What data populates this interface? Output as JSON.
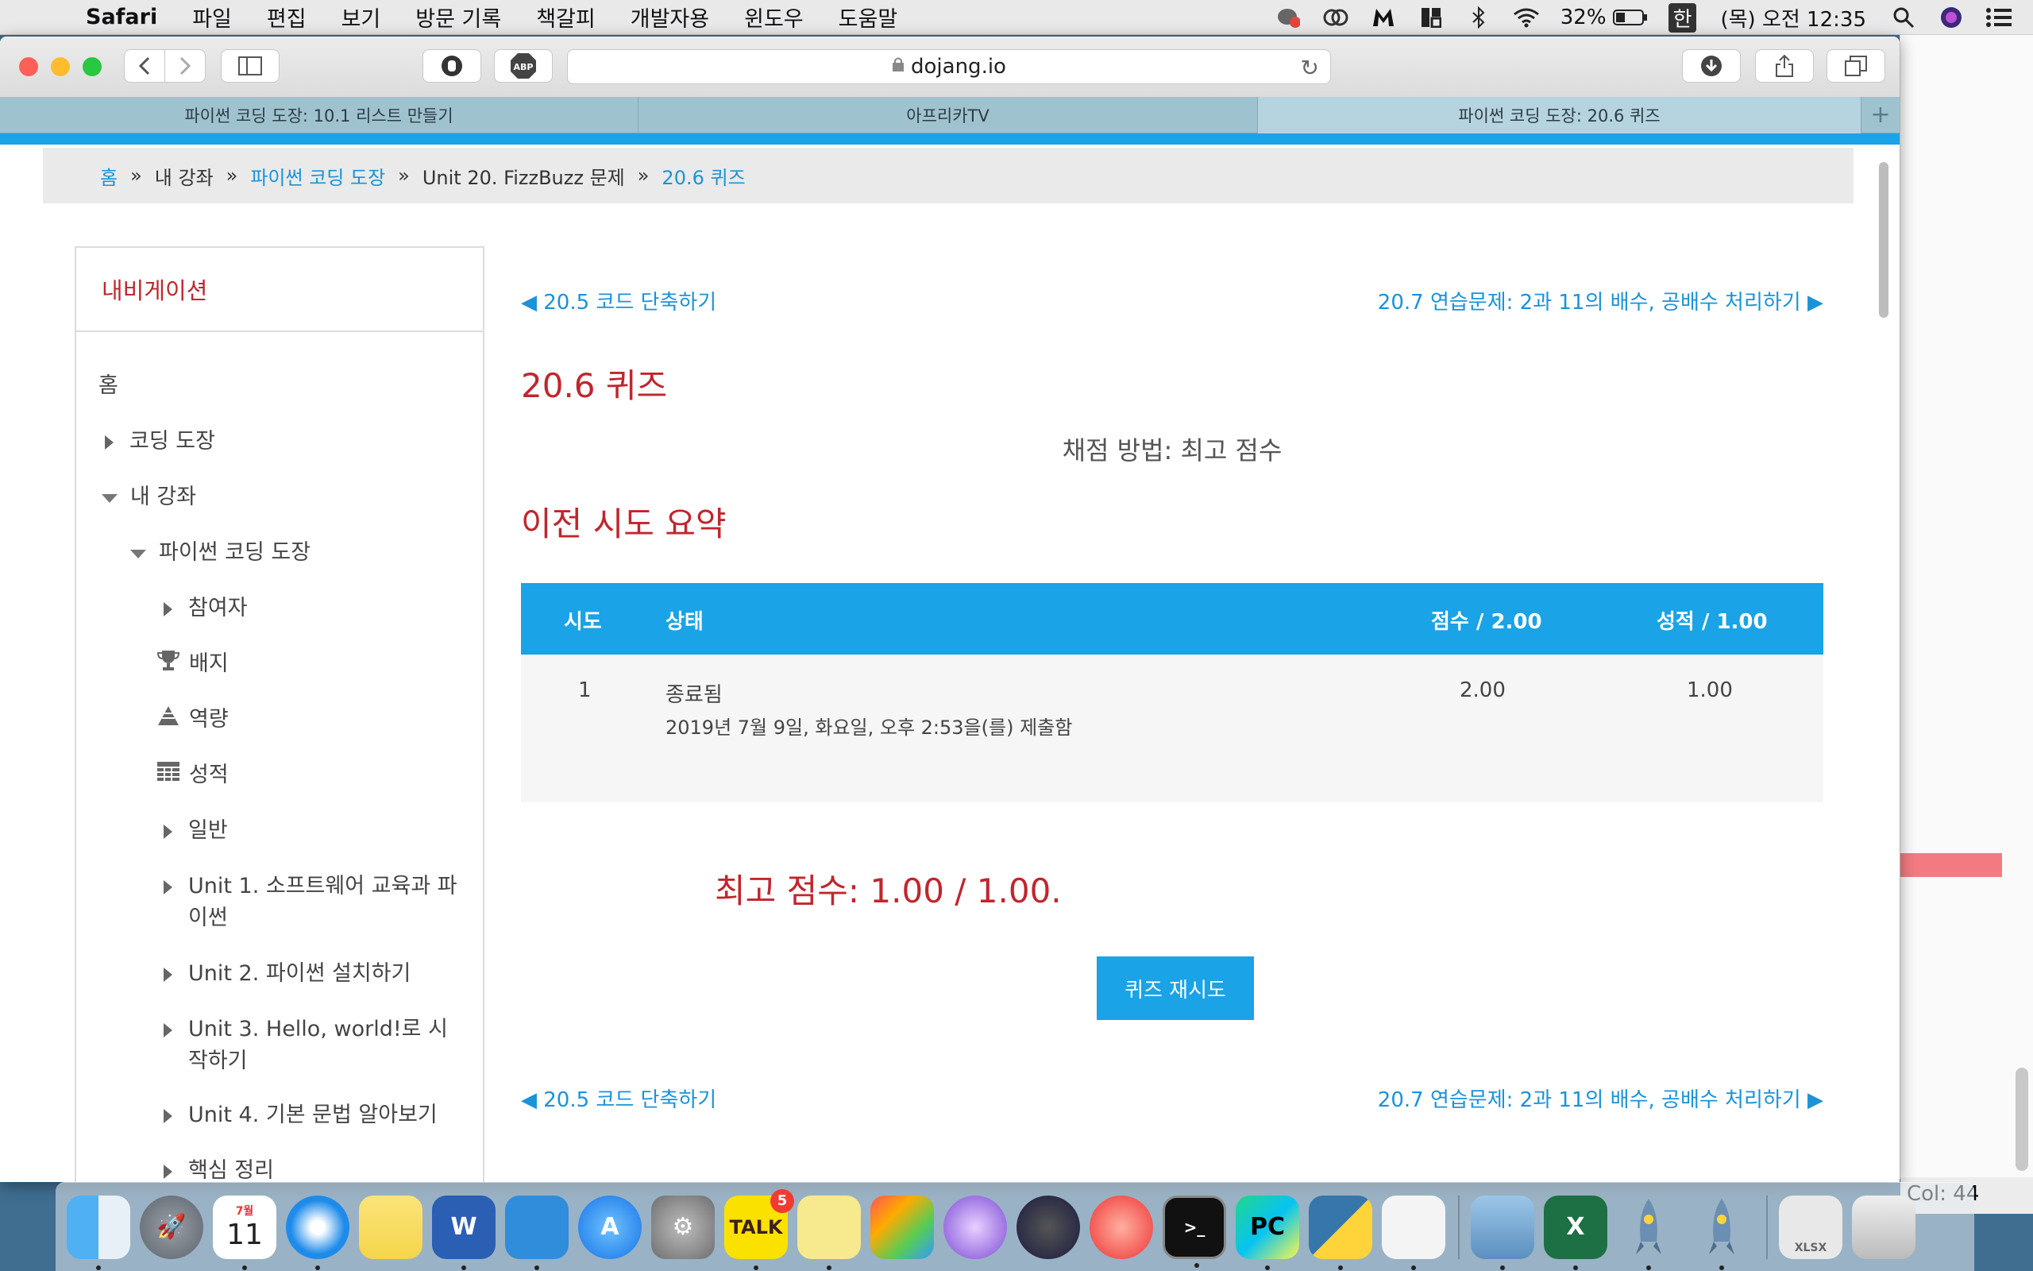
{
  "menubar": {
    "app_name": "Safari",
    "menus": [
      "파일",
      "편집",
      "보기",
      "방문 기록",
      "책갈피",
      "개발자용",
      "윈도우",
      "도움말"
    ],
    "battery": "32%",
    "input_source": "한",
    "clock": "(목) 오전 12:35"
  },
  "browser": {
    "url": "dojang.io",
    "tabs": [
      {
        "label": "파이썬 코딩 도장: 10.1 리스트 만들기"
      },
      {
        "label": "아프리카TV"
      },
      {
        "label": "파이썬 코딩 도장: 20.6 퀴즈"
      }
    ],
    "adblock_label": "ABP"
  },
  "breadcrumb": {
    "home": "홈",
    "my_courses": "내 강좌",
    "course": "파이썬 코딩 도장",
    "unit": "Unit 20. FizzBuzz 문제",
    "current": "20.6 퀴즈"
  },
  "navigation": {
    "title": "내비게이션",
    "items": [
      {
        "label": "홈"
      },
      {
        "label": "코딩 도장"
      },
      {
        "label": "내 강좌"
      },
      {
        "label": "파이썬 코딩 도장"
      },
      {
        "label": "참여자"
      },
      {
        "label": "배지"
      },
      {
        "label": "역량"
      },
      {
        "label": "성적"
      },
      {
        "label": "일반"
      },
      {
        "label": "Unit 1. 소프트웨어 교육과 파이썬"
      },
      {
        "label": "Unit 2. 파이썬 설치하기"
      },
      {
        "label": "Unit 3. Hello, world!로 시작하기"
      },
      {
        "label": "Unit 4. 기본 문법 알아보기"
      },
      {
        "label": "핵심 정리"
      }
    ]
  },
  "main": {
    "prev_link": "◀ 20.5 코드 단축하기",
    "next_link": "20.7 연습문제: 2과 11의 배수, 공배수 처리하기 ▶",
    "title": "20.6 퀴즈",
    "grading_method": "채점 방법: 최고 점수",
    "summary_title": "이전 시도 요약",
    "table": {
      "headers": [
        "시도",
        "상태",
        "점수 / 2.00",
        "성적 / 1.00"
      ],
      "rows": [
        {
          "attempt": "1",
          "status": "종료됨",
          "submitted": "2019년 7월 9일, 화요일, 오후 2:53을(를) 제출함",
          "score": "2.00",
          "grade": "1.00"
        }
      ]
    },
    "best_score": "최고 점수: 1.00 / 1.00.",
    "retry_button": "퀴즈 재시도"
  },
  "background_app": {
    "status": "Col: 44"
  },
  "dock": {
    "calendar_month": "7월",
    "calendar_day": "11",
    "kakao_label": "TALK",
    "kakao_badge": "5",
    "pycharm_label": "PC",
    "excel_label": "X",
    "word_label": "W",
    "file_label": "XLSX"
  }
}
